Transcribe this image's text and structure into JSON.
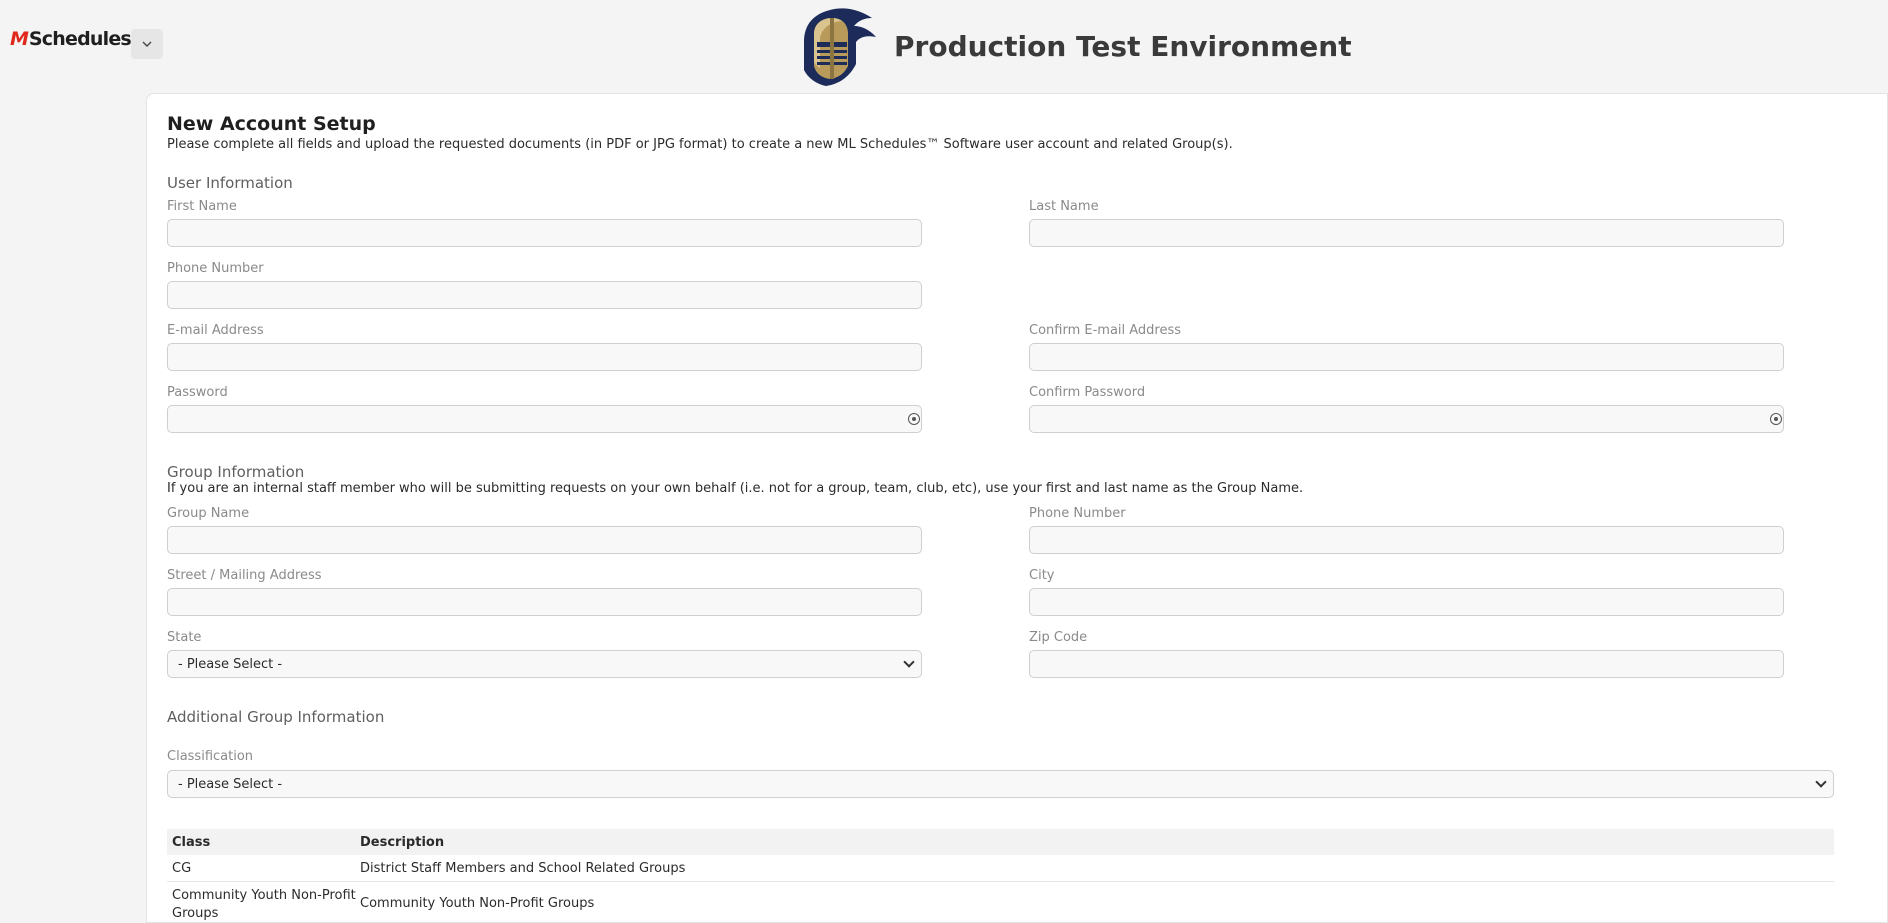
{
  "app": {
    "brand_mark": "M",
    "brand_name": "Schedules",
    "environment_title": "Production Test Environment",
    "icons": {
      "menu": "chevron-down-icon",
      "logo": "knight-helmet-logo",
      "password_toggle": "eye-icon"
    }
  },
  "form": {
    "title": "New Account Setup",
    "intro": "Please complete all fields and upload the requested documents (in PDF or JPG format) to create a new ML Schedules™ Software user account and related Group(s).",
    "user_info": {
      "title": "User Information",
      "first_name": {
        "label": "First Name",
        "value": ""
      },
      "last_name": {
        "label": "Last Name",
        "value": ""
      },
      "phone": {
        "label": "Phone Number",
        "value": ""
      },
      "email": {
        "label": "E-mail Address",
        "value": ""
      },
      "confirm_email": {
        "label": "Confirm E-mail Address",
        "value": ""
      },
      "password": {
        "label": "Password",
        "value": ""
      },
      "confirm_password": {
        "label": "Confirm Password",
        "value": ""
      }
    },
    "group_info": {
      "title": "Group Information",
      "note": "If you are an internal staff member who will be submitting requests on your own behalf (i.e. not for a group, team, club, etc), use your first and last name as the Group Name.",
      "group_name": {
        "label": "Group Name",
        "value": ""
      },
      "phone": {
        "label": "Phone Number",
        "value": ""
      },
      "street": {
        "label": "Street / Mailing Address",
        "value": ""
      },
      "city": {
        "label": "City",
        "value": ""
      },
      "state": {
        "label": "State",
        "selected": "- Please Select -"
      },
      "zip": {
        "label": "Zip Code",
        "value": ""
      }
    },
    "additional": {
      "title": "Additional Group Information",
      "classification": {
        "label": "Classification",
        "selected": "- Please Select -"
      }
    },
    "class_table": {
      "headers": [
        "Class",
        "Description"
      ],
      "rows": [
        {
          "class": "CG",
          "description": "District Staff Members and School Related Groups"
        },
        {
          "class": "Community Youth Non-Profit Groups",
          "description": "Community Youth Non-Profit Groups"
        }
      ]
    }
  }
}
